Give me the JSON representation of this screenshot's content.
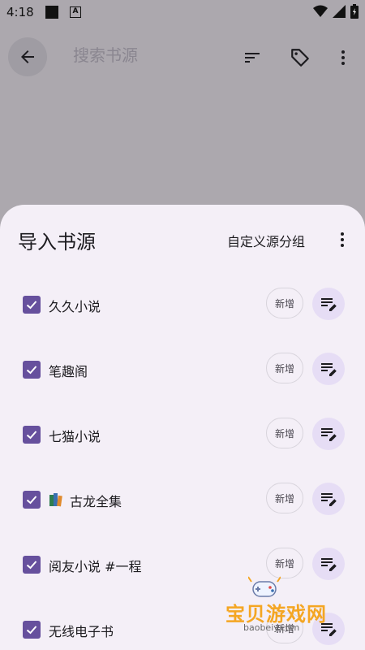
{
  "status": {
    "time": "4:18"
  },
  "appbar": {
    "search_placeholder": "搜索书源"
  },
  "sheet": {
    "title": "导入书源",
    "group_label": "自定义源分组",
    "items": [
      {
        "label": "久久小说",
        "badge": "新增",
        "checked": true
      },
      {
        "label": "笔趣阁",
        "badge": "新增",
        "checked": true
      },
      {
        "label": "七猫小说",
        "badge": "新增",
        "checked": true
      },
      {
        "label": "古龙全集",
        "badge": "新增",
        "checked": true,
        "has_book_icon": true
      },
      {
        "label": "阅友小说 #一程",
        "badge": "新增",
        "checked": true
      },
      {
        "label": "无线电子书",
        "badge": "新增",
        "checked": true
      }
    ]
  },
  "watermark": {
    "brand": "宝贝游戏网",
    "url": "baobeiy.com"
  },
  "colors": {
    "accent": "#66509d",
    "sheet_bg": "#f4eff7",
    "scrim": "#aca8ae",
    "edit_bg": "#e6ddf5",
    "watermark": "#f4a623"
  }
}
